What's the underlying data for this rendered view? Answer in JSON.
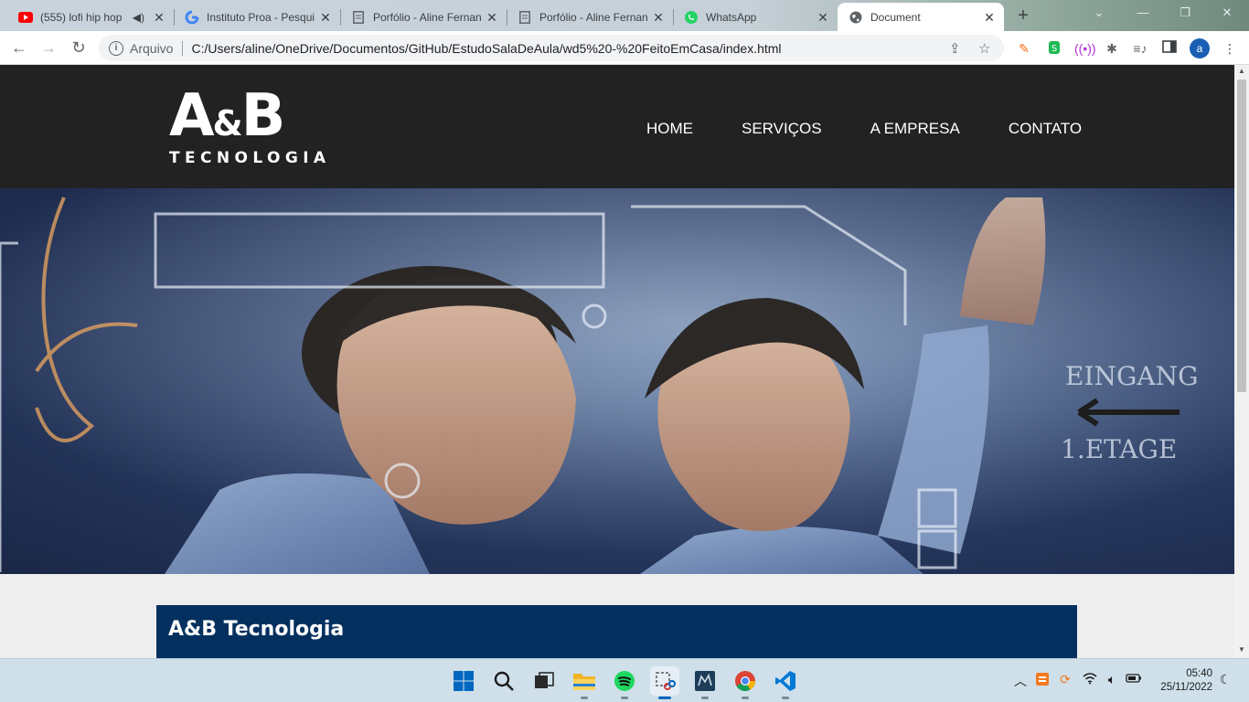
{
  "browser": {
    "tabs": [
      {
        "title": "(555) lofi hip hop",
        "icon": "youtube-icon",
        "audio": true
      },
      {
        "title": "Instituto Proa - Pesqui",
        "icon": "google-icon"
      },
      {
        "title": "Porfólio - Aline Fernan",
        "icon": "document-icon"
      },
      {
        "title": "Porfólio - Aline Fernan",
        "icon": "document-icon"
      },
      {
        "title": "WhatsApp",
        "icon": "whatsapp-icon"
      },
      {
        "title": "Document",
        "icon": "globe-icon",
        "active": true
      }
    ],
    "close_glyph": "✕",
    "new_tab_glyph": "+",
    "address": {
      "scheme_label": "Arquivo",
      "url": "C:/Users/aline/OneDrive/Documentos/GitHub/EstudoSalaDeAula/wd5%20-%20FeitoEmCasa/index.html"
    },
    "profile_initial": "a"
  },
  "site": {
    "logo": {
      "main_left": "A",
      "amp": "&",
      "main_right": "B",
      "sub": "TECNOLOGIA"
    },
    "nav": [
      "HOME",
      "SERVIÇOS",
      "A EMPRESA",
      "CONTATO"
    ],
    "content_title": "A&B Tecnologia"
  },
  "taskbar": {
    "apps": [
      "windows-start-icon",
      "search-icon",
      "task-view-icon",
      "file-explorer-icon",
      "spotify-icon",
      "snipping-tool-icon",
      "mysql-workbench-icon",
      "chrome-icon",
      "vscode-icon"
    ],
    "clock": {
      "time": "05:40",
      "date": "25/11/2022"
    }
  },
  "colors": {
    "header_bg": "#222222",
    "content_band": "#03305f",
    "page_bg": "#eeeeee",
    "accent": "#0067c0"
  }
}
